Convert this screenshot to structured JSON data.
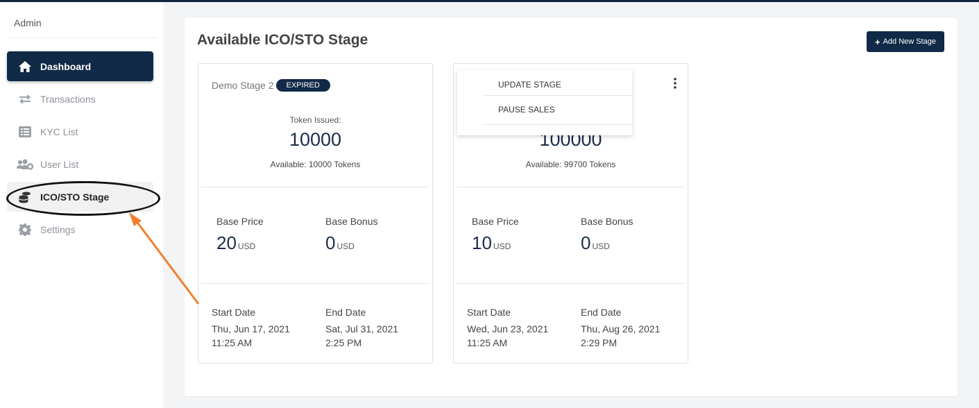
{
  "sidebar": {
    "admin_label": "Admin",
    "items": [
      {
        "label": "Dashboard",
        "icon": "home-icon",
        "state": "active"
      },
      {
        "label": "Transactions",
        "icon": "arrows-icon",
        "state": "normal"
      },
      {
        "label": "KYC List",
        "icon": "list-icon",
        "state": "normal"
      },
      {
        "label": "User List",
        "icon": "users-icon",
        "state": "normal"
      },
      {
        "label": "ICO/STO Stage",
        "icon": "coins-icon",
        "state": "highlighted"
      },
      {
        "label": "Settings",
        "icon": "gear-icon",
        "state": "normal"
      }
    ]
  },
  "header": {
    "title": "Available ICO/STO Stage",
    "add_button": "Add New Stage"
  },
  "cards": [
    {
      "name": "Demo Stage 2",
      "badge": "EXPIRED",
      "token_label": "Token Issued:",
      "token_value": "10000",
      "available": "Available: 10000 Tokens",
      "base_price_label": "Base Price",
      "base_price": "20",
      "base_price_unit": "USD",
      "base_bonus_label": "Base Bonus",
      "base_bonus": "0",
      "base_bonus_unit": "USD",
      "start_label": "Start Date",
      "start_date": "Thu, Jun 17, 2021",
      "start_time": "11:25 AM",
      "end_label": "End Date",
      "end_date": "Sat, Jul 31, 2021",
      "end_time": "2:25 PM"
    },
    {
      "token_value": "100000",
      "available": "Available: 99700 Tokens",
      "base_price_label": "Base Price",
      "base_price": "10",
      "base_price_unit": "USD",
      "base_bonus_label": "Base Bonus",
      "base_bonus": "0",
      "base_bonus_unit": "USD",
      "start_label": "Start Date",
      "start_date": "Wed, Jun 23, 2021",
      "start_time": "11:25 AM",
      "end_label": "End Date",
      "end_date": "Thu, Aug 26, 2021",
      "end_time": "2:29 PM"
    }
  ],
  "dropdown": {
    "items": [
      "UPDATE STAGE",
      "PAUSE SALES"
    ]
  },
  "colors": {
    "navy": "#102a47",
    "annotation_arrow": "#f07f2e"
  }
}
